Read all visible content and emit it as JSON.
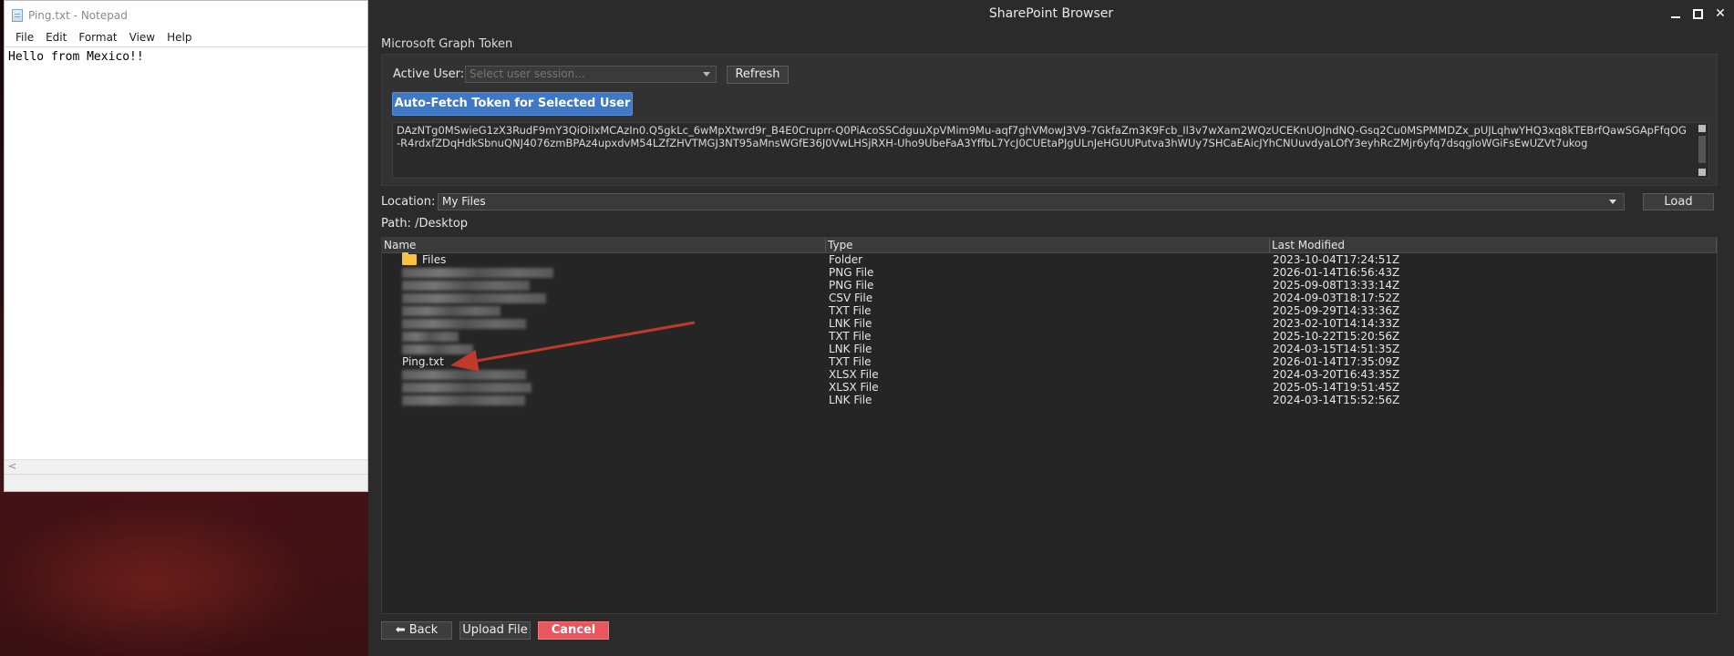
{
  "notepad": {
    "title": "Ping.txt - Notepad",
    "menu": [
      "File",
      "Edit",
      "Format",
      "View",
      "Help"
    ],
    "content": "Hello from Mexico!!",
    "hscroll_left": "<"
  },
  "app": {
    "title": "SharePoint Browser",
    "window_controls": [
      "minimize-icon",
      "maximize-icon",
      "close-icon"
    ],
    "section_label": "Microsoft Graph Token",
    "active_user_label": "Active User:",
    "user_select_placeholder": "Select user session...",
    "refresh_label": "Refresh",
    "autofetch_label": "Auto-Fetch Token for Selected User",
    "token_text": "DAzNTg0MSwieG1zX3RudF9mY3QiOiIxMCAzIn0.Q5gkLc_6wMpXtwrd9r_B4E0Cruprr-Q0PiAcoSSCdguuXpVMim9Mu-aqf7ghVMowJ3V9-7GkfaZm3K9Fcb_Il3v7wXam2WQzUCEKnUOJndNQ-Gsq2Cu0MSPMMDZx_pUJLqhwYHQ3xq8kTEBrfQawSGApFfqOG-R4rdxfZDqHdkSbnuQNJ4076zmBPAz4upxdvM54LZfZHVTMGJ3NT95aMnsWGfE36J0VwLHSjRXH-Uho9UbeFaA3YffbL7YcJ0CUEtaPJgULnJeHGUUPutva3hWUy7SHCaEAicJYhCNUuvdyaLOfY3eyhRcZMjr6yfq7dsqgIoWGiFsEwUZVt7ukog",
    "location_label": "Location:",
    "location_value": "My Files",
    "load_label": "Load",
    "path_label": "Path: /Desktop",
    "columns": [
      "Name",
      "Type",
      "Last Modified"
    ],
    "rows": [
      {
        "name": "Files",
        "type": "Folder",
        "modified": "2023-10-04T17:24:51Z"
      },
      {
        "name": "",
        "type": "PNG File",
        "modified": "2026-01-14T16:56:43Z"
      },
      {
        "name": "",
        "type": "PNG File",
        "modified": "2025-09-08T13:33:14Z"
      },
      {
        "name": "",
        "type": "CSV File",
        "modified": "2024-09-03T18:17:52Z"
      },
      {
        "name": "",
        "type": "TXT File",
        "modified": "2025-09-29T14:33:36Z"
      },
      {
        "name": "",
        "type": "LNK File",
        "modified": "2023-02-10T14:14:33Z"
      },
      {
        "name": "",
        "type": "TXT File",
        "modified": "2025-10-22T15:20:56Z"
      },
      {
        "name": "",
        "type": "LNK File",
        "modified": "2024-03-15T14:51:35Z"
      },
      {
        "name": "Ping.txt",
        "type": "TXT File",
        "modified": "2026-01-14T17:35:09Z"
      },
      {
        "name": "",
        "type": "XLSX File",
        "modified": "2024-03-20T16:43:35Z"
      },
      {
        "name": "",
        "type": "XLSX File",
        "modified": "2025-05-14T19:51:45Z"
      },
      {
        "name": "",
        "type": "LNK File",
        "modified": "2024-03-14T15:52:56Z"
      }
    ],
    "back_label": "⬅ Back",
    "upload_label": "Upload File",
    "cancel_label": "Cancel",
    "colors": {
      "accent_blue": "#3f78c6",
      "cancel_red": "#e8565e",
      "annotation_arrow": "#c0392b"
    }
  }
}
